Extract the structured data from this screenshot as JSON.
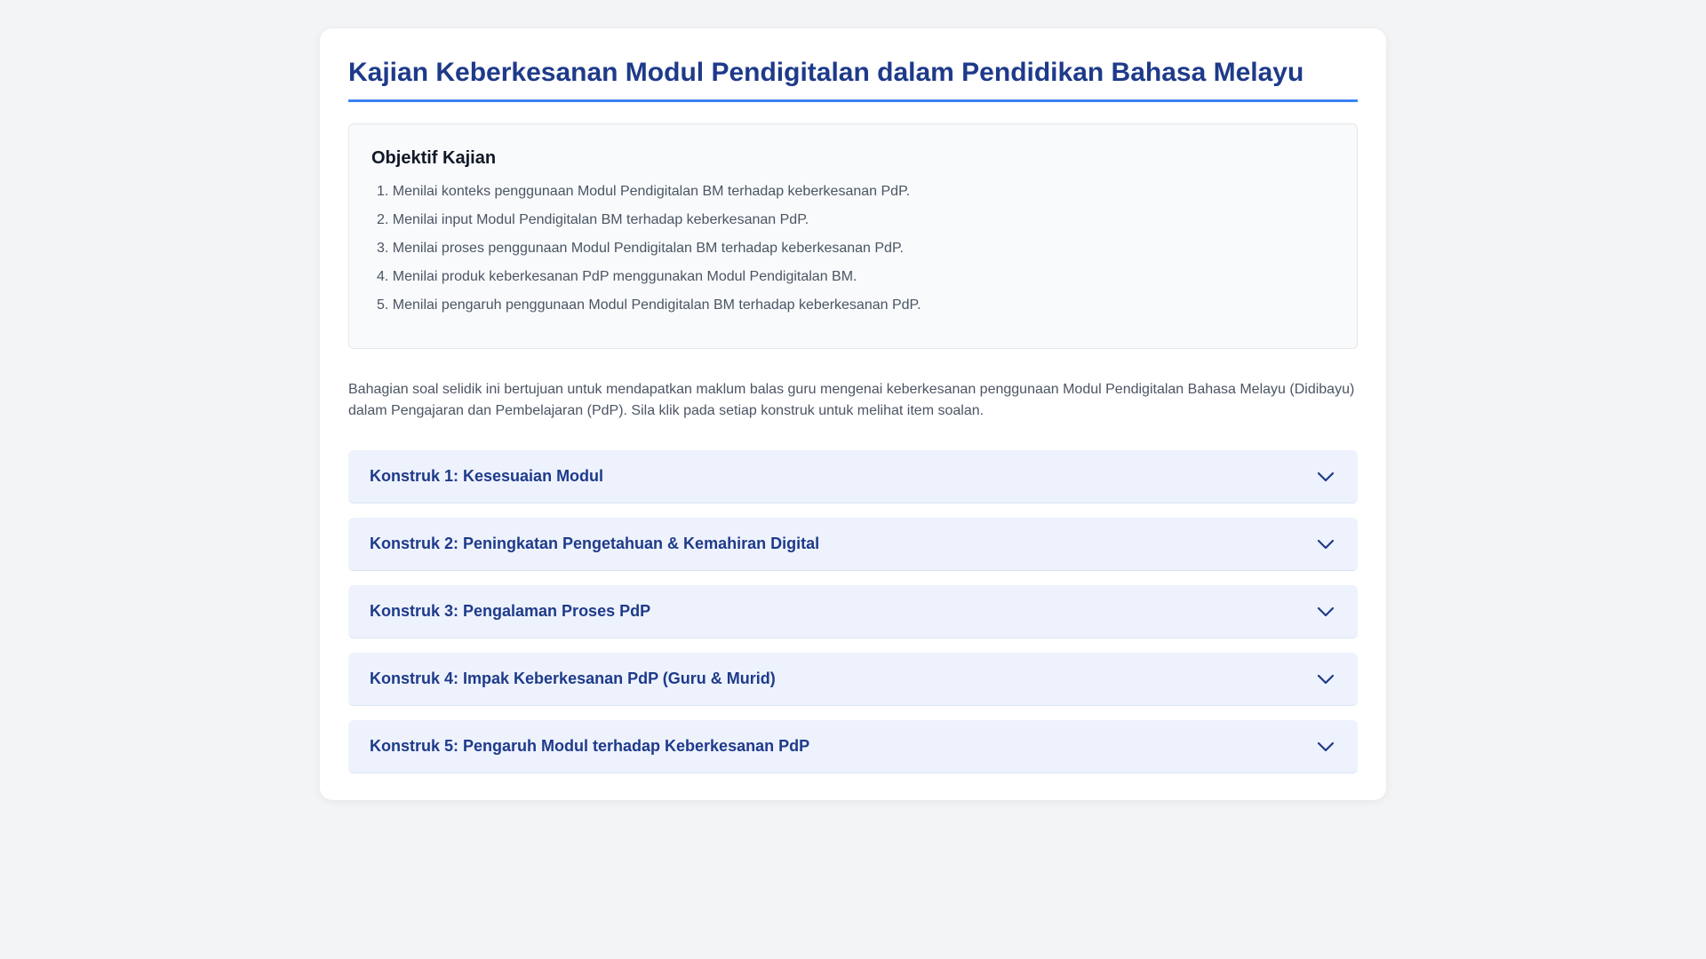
{
  "page": {
    "title": "Kajian Keberkesanan Modul Pendigitalan dalam Pendidikan Bahasa Melayu"
  },
  "objectives": {
    "heading": "Objektif Kajian",
    "items": [
      "1. Menilai konteks penggunaan Modul Pendigitalan BM terhadap keberkesanan PdP.",
      "2. Menilai input Modul Pendigitalan BM terhadap keberkesanan PdP.",
      "3. Menilai proses penggunaan Modul Pendigitalan BM terhadap keberkesanan PdP.",
      "4. Menilai produk keberkesanan PdP menggunakan Modul Pendigitalan BM.",
      "5. Menilai pengaruh penggunaan Modul Pendigitalan BM terhadap keberkesanan PdP."
    ]
  },
  "intro": "Bahagian soal selidik ini bertujuan untuk mendapatkan maklum balas guru mengenai keberkesanan penggunaan Modul Pendigitalan Bahasa Melayu (Didibayu) dalam Pengajaran dan Pembelajaran (PdP). Sila klik pada setiap konstruk untuk melihat item soalan.",
  "accordion": {
    "icon": "chevron-down-icon",
    "accent_color": "#1e3a8a",
    "items": [
      {
        "label": "Konstruk 1: Kesesuaian Modul"
      },
      {
        "label": "Konstruk 2: Peningkatan Pengetahuan & Kemahiran Digital"
      },
      {
        "label": "Konstruk 3: Pengalaman Proses PdP"
      },
      {
        "label": "Konstruk 4: Impak Keberkesanan PdP (Guru & Murid)"
      },
      {
        "label": "Konstruk 5: Pengaruh Modul terhadap Keberkesanan PdP"
      }
    ]
  }
}
